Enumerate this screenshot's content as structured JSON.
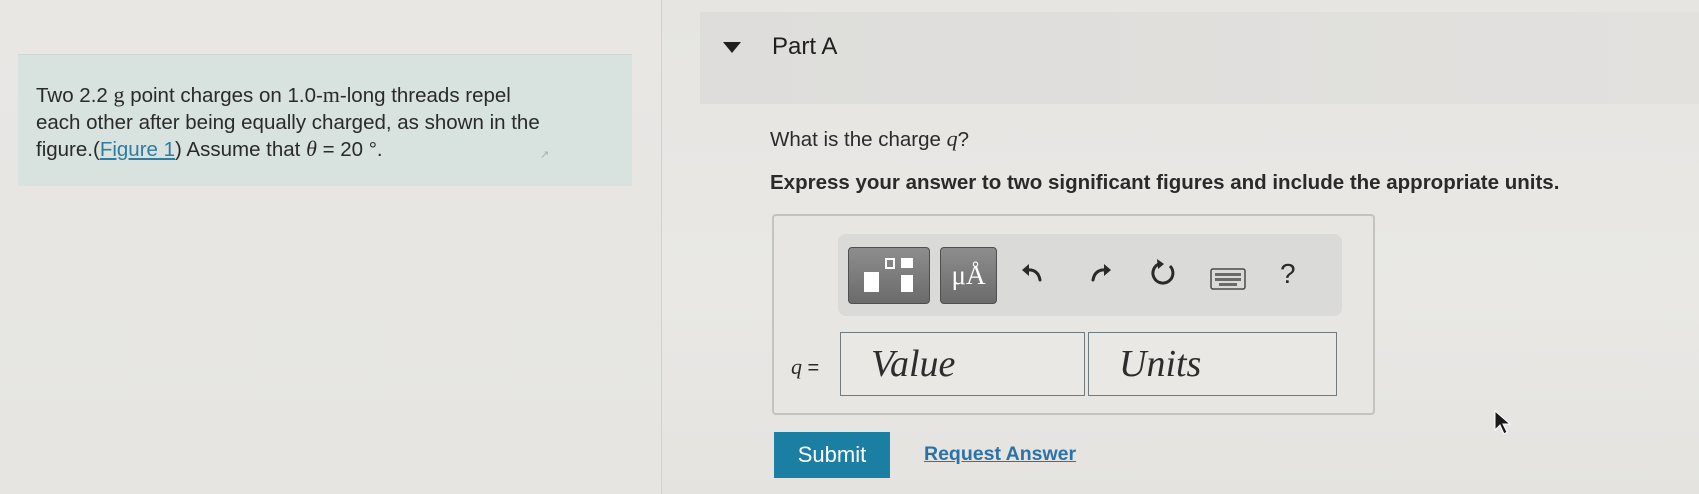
{
  "problem": {
    "line1_a": "Two 2.2 ",
    "line1_unit": "g",
    "line1_b": " point charges on 1.0-",
    "line1_unit2": "m",
    "line1_c": "-long threads repel",
    "line2": "each other after being equally charged, as shown in the",
    "line3_a": "figure.(",
    "figure_link": "Figure 1",
    "line3_b": ") Assume that ",
    "theta": "θ",
    "line3_c": " = 20 °."
  },
  "part": {
    "title": "Part A",
    "question_a": "What is the charge ",
    "question_var": "q",
    "question_b": "?",
    "instruction": "Express your answer to two significant figures and include the appropriate units."
  },
  "answer": {
    "var_label": "q",
    "equals": " =",
    "value_placeholder": "Value",
    "units_placeholder": "Units",
    "units_button": "μÅ",
    "help": "?"
  },
  "actions": {
    "submit": "Submit",
    "request_answer": "Request Answer"
  },
  "colors": {
    "accent": "#1b7fa3",
    "link": "#2b72a8",
    "problem_bg": "#d8e2de"
  },
  "icons": [
    "template-icon",
    "undo-icon",
    "redo-icon",
    "reset-icon",
    "keyboard-icon",
    "help-icon",
    "caret-down-icon",
    "external-link-icon",
    "cursor-icon"
  ]
}
